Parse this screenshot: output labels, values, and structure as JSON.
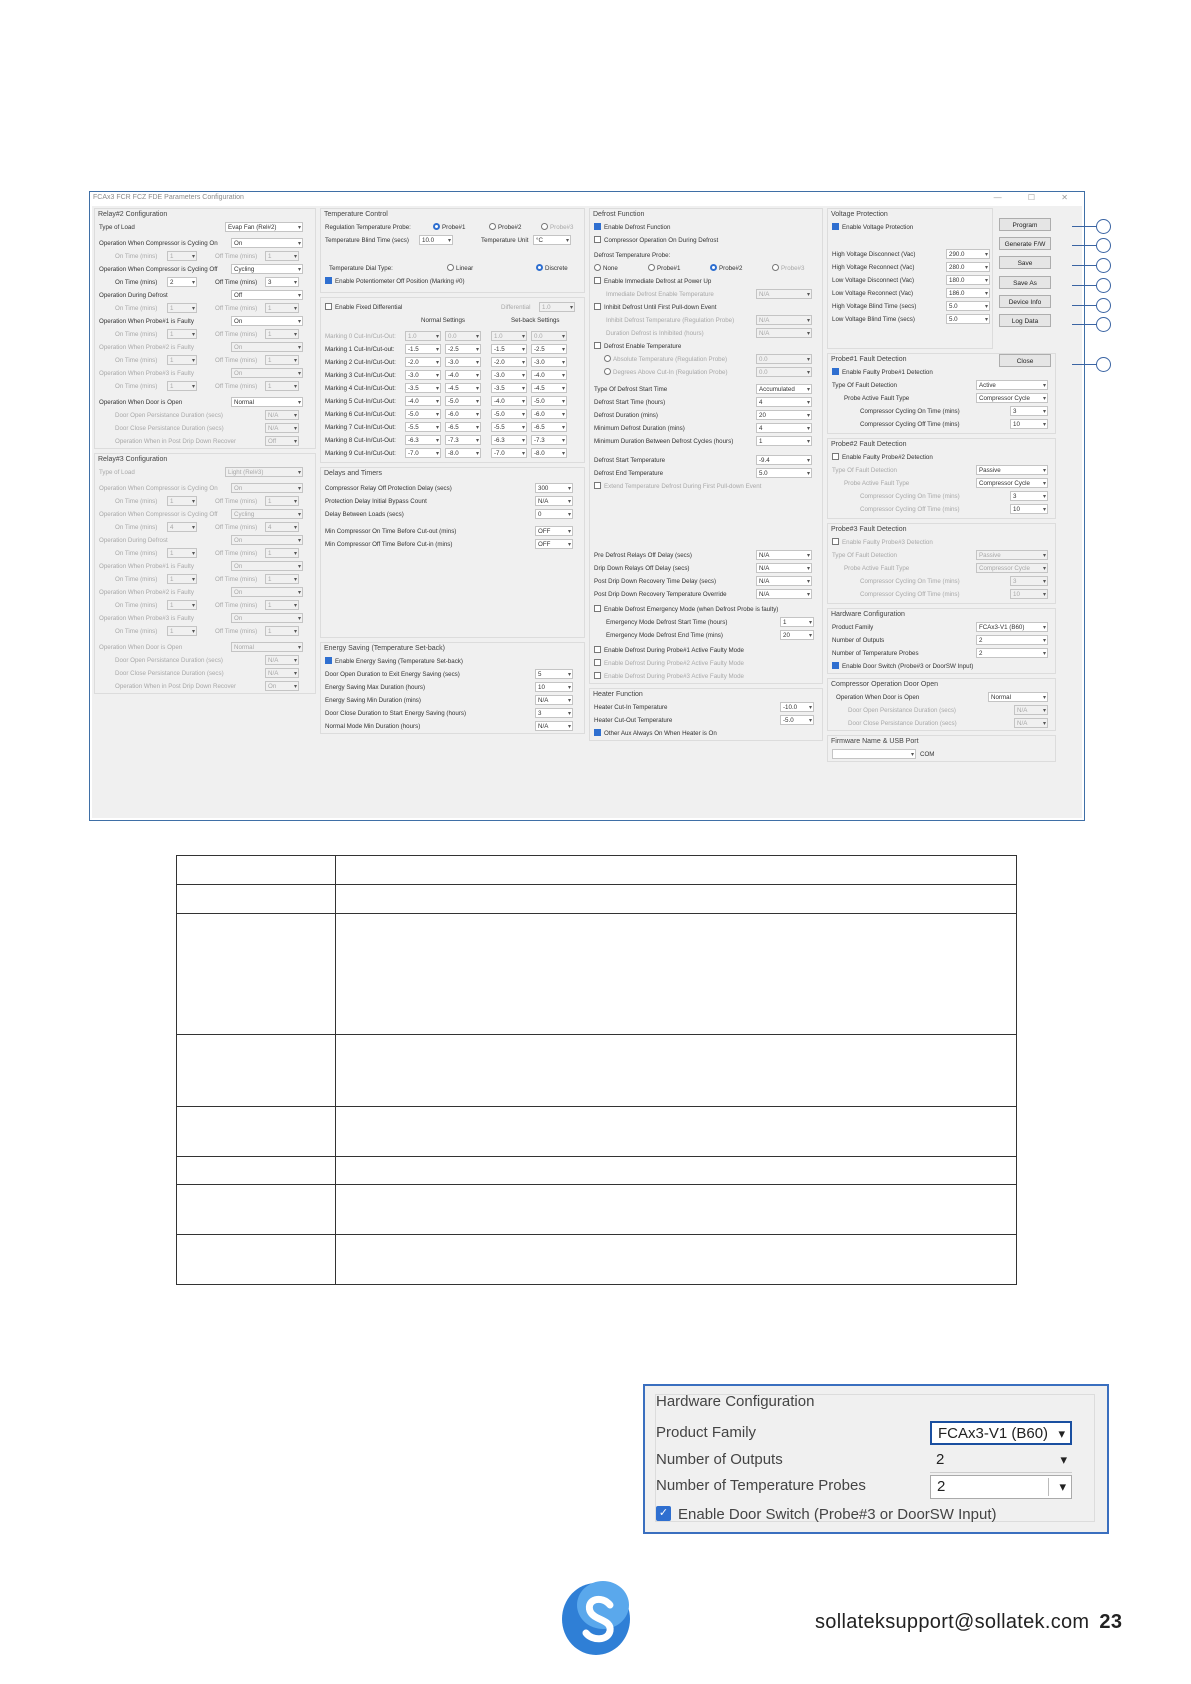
{
  "window": {
    "title": "FCAx3 FCR FCZ FDE Parameters Configuration",
    "controls": "— ☐ ✕"
  },
  "col1": {
    "relay2": {
      "header": "Relay#2 Configuration",
      "type_label": "Type of Load",
      "type_value": "Evap Fan (Rel#2)",
      "rows": [
        {
          "label": "Operation When Compressor is Cycling On",
          "value": "On",
          "dim": false
        },
        {
          "label": "On Time (mins)",
          "v1": "1",
          "label2": "Off Time (mins)",
          "v2": "1",
          "dim": true
        },
        {
          "label": "Operation When Compressor is Cycling Off",
          "value": "Cycling",
          "dim": false
        },
        {
          "label": "On Time (mins)",
          "v1": "2",
          "label2": "Off Time (mins)",
          "v2": "3",
          "dim": false
        },
        {
          "label": "Operation During Defrost",
          "value": "Off",
          "dim": false
        },
        {
          "label": "On Time (mins)",
          "v1": "1",
          "label2": "Off Time (mins)",
          "v2": "1",
          "dim": true
        },
        {
          "label": "Operation When Probe#1 is Faulty",
          "value": "On",
          "dim": false
        },
        {
          "label": "On Time (mins)",
          "v1": "1",
          "label2": "Off Time (mins)",
          "v2": "1",
          "dim": true
        },
        {
          "label": "Operation When Probe#2 is Faulty",
          "value": "On",
          "dim": true
        },
        {
          "label": "On Time (mins)",
          "v1": "1",
          "label2": "Off Time (mins)",
          "v2": "1",
          "dim": true
        },
        {
          "label": "Operation When Probe#3 is Faulty",
          "value": "On",
          "dim": true
        },
        {
          "label": "On Time (mins)",
          "v1": "1",
          "label2": "Off Time (mins)",
          "v2": "1",
          "dim": true
        },
        {
          "label": "Operation When Door is Open",
          "value": "Normal",
          "dim": false
        },
        {
          "label": "Door Open Persistance Duration (secs)",
          "value": "N/A",
          "dim": true
        },
        {
          "label": "Door Close Persistance Duration (secs)",
          "value": "N/A",
          "dim": true
        },
        {
          "label": "Operation When in Post Drip Down Recover",
          "value": "Off",
          "dim": true
        }
      ]
    },
    "relay3": {
      "header": "Relay#3 Configuration",
      "type_label": "Type of Load",
      "type_value": "Light (Rel#3)",
      "rows": [
        {
          "label": "Operation When Compressor is Cycling On",
          "value": "On",
          "dim": true
        },
        {
          "label": "On Time (mins)",
          "v1": "1",
          "label2": "Off Time (mins)",
          "v2": "1",
          "dim": true
        },
        {
          "label": "Operation When Compressor is Cycling Off",
          "value": "Cycling",
          "dim": true
        },
        {
          "label": "On Time (mins)",
          "v1": "4",
          "label2": "Off Time (mins)",
          "v2": "4",
          "dim": true
        },
        {
          "label": "Operation During Defrost",
          "value": "On",
          "dim": true
        },
        {
          "label": "On Time (mins)",
          "v1": "1",
          "label2": "Off Time (mins)",
          "v2": "1",
          "dim": true
        },
        {
          "label": "Operation When Probe#1 is Faulty",
          "value": "On",
          "dim": true
        },
        {
          "label": "On Time (mins)",
          "v1": "1",
          "label2": "Off Time (mins)",
          "v2": "1",
          "dim": true
        },
        {
          "label": "Operation When Probe#2 is Faulty",
          "value": "On",
          "dim": true
        },
        {
          "label": "On Time (mins)",
          "v1": "1",
          "label2": "Off Time (mins)",
          "v2": "1",
          "dim": true
        },
        {
          "label": "Operation When Probe#3 is Faulty",
          "value": "On",
          "dim": true
        },
        {
          "label": "On Time (mins)",
          "v1": "1",
          "label2": "Off Time (mins)",
          "v2": "1",
          "dim": true
        },
        {
          "label": "Operation When Door is Open",
          "value": "Normal",
          "dim": true
        },
        {
          "label": "Door Open Persistance Duration (secs)",
          "value": "N/A",
          "dim": true
        },
        {
          "label": "Door Close Persistance Duration (secs)",
          "value": "N/A",
          "dim": true
        },
        {
          "label": "Operation When in Post Drip Down Recover",
          "value": "On",
          "dim": true
        }
      ]
    }
  },
  "col2": {
    "temp": {
      "header": "Temperature Control",
      "reg_label": "Regulation Temperature Probe:",
      "probes": [
        "Probe#1",
        "Probe#2",
        "Probe#3"
      ],
      "blind_label": "Temperature Blind Time (secs)",
      "blind_value": "10.0",
      "unit_label": "Temperature Unit",
      "unit_value": "°C",
      "dial_label": "Temperature Dial Type:",
      "dial_linear": "Linear",
      "dial_discrete": "Discrete",
      "pot_label": "Enable Potentiometer Off Position (Marking #0)"
    },
    "diff": {
      "fixed_label": "Enable Fixed Differential",
      "diff_label": "Differential",
      "diff_value": "1.0",
      "normal_head": "Normal Settings",
      "setback_head": "Set-back Settings",
      "markings": [
        {
          "label": "Marking 0 Cut-In/Cut-Out:",
          "a": "1.0",
          "b": "0.0",
          "c": "1.0",
          "d": "0.0",
          "dim": true
        },
        {
          "label": "Marking 1 Cut-In/Cut-out:",
          "a": "-1.5",
          "b": "-2.5",
          "c": "-1.5",
          "d": "-2.5",
          "dim": false
        },
        {
          "label": "Marking 2 Cut-In/Cut-Out:",
          "a": "-2.0",
          "b": "-3.0",
          "c": "-2.0",
          "d": "-3.0",
          "dim": false
        },
        {
          "label": "Marking 3 Cut-In/Cut-Out:",
          "a": "-3.0",
          "b": "-4.0",
          "c": "-3.0",
          "d": "-4.0",
          "dim": false
        },
        {
          "label": "Marking 4 Cut-In/Cut-Out:",
          "a": "-3.5",
          "b": "-4.5",
          "c": "-3.5",
          "d": "-4.5",
          "dim": false
        },
        {
          "label": "Marking 5 Cut-In/Cut-Out:",
          "a": "-4.0",
          "b": "-5.0",
          "c": "-4.0",
          "d": "-5.0",
          "dim": false
        },
        {
          "label": "Marking 6 Cut-In/Cut-Out:",
          "a": "-5.0",
          "b": "-6.0",
          "c": "-5.0",
          "d": "-6.0",
          "dim": false
        },
        {
          "label": "Marking 7 Cut-In/Cut-Out:",
          "a": "-5.5",
          "b": "-6.5",
          "c": "-5.5",
          "d": "-6.5",
          "dim": false
        },
        {
          "label": "Marking 8 Cut-In/Cut-Out:",
          "a": "-6.3",
          "b": "-7.3",
          "c": "-6.3",
          "d": "-7.3",
          "dim": false
        },
        {
          "label": "Marking 9 Cut-In/Cut-Out:",
          "a": "-7.0",
          "b": "-8.0",
          "c": "-7.0",
          "d": "-8.0",
          "dim": false
        }
      ]
    },
    "delays": {
      "header": "Delays and Timers",
      "rows": [
        {
          "label": "Compressor Relay Off Protection Delay (secs)",
          "value": "300"
        },
        {
          "label": "Protection Delay Initial Bypass Count",
          "value": "N/A"
        },
        {
          "label": "Delay Between Loads (secs)",
          "value": "0"
        },
        {
          "label": "Min Compressor On Time Before Cut-out (mins)",
          "value": "OFF"
        },
        {
          "label": "Min Compressor Off Time Before Cut-in (mins)",
          "value": "OFF"
        }
      ]
    },
    "energy": {
      "header": "Energy Saving (Temperature Set-back)",
      "enable_label": "Enable Energy Saving (Temperature Set-back)",
      "rows": [
        {
          "label": "Door Open Duration to Exit Energy Saving (secs)",
          "value": "5"
        },
        {
          "label": "Energy Saving Max Duration (hours)",
          "value": "10"
        },
        {
          "label": "Energy Saving Min Duration (mins)",
          "value": "N/A"
        },
        {
          "label": "Door Close Duration to Start Energy Saving (hours)",
          "value": "3"
        },
        {
          "label": "Normal Mode Min Duration (hours)",
          "value": "N/A"
        }
      ]
    }
  },
  "col3": {
    "defrost": {
      "header": "Defrost Function",
      "enable": "Enable Defrost Function",
      "comp_op": "Compressor Operation On During Defrost",
      "probe_label": "Defrost Temperature Probe:",
      "probe_opts": [
        "None",
        "Probe#1",
        "Probe#2",
        "Probe#3"
      ],
      "immediate": "Enable Immediate Defrost at Power Up",
      "immediate_temp_label": "Immediate Defrost Enable Temperature",
      "immediate_temp_value": "N/A",
      "inhibit": "Inhibit Defrost Until First Pull-down Event",
      "inhibit_temp_label": "Inhibit Defrost Temperature (Regulation Probe)",
      "inhibit_temp_value": "N/A",
      "inhibit_dur_label": "Duration Defrost is Inhibited (hours)",
      "inhibit_dur_value": "N/A",
      "enable_temp": "Defrost Enable Temperature",
      "abs_label": "Absolute Temperature (Regulation Probe)",
      "abs_value": "0.0",
      "deg_label": "Degrees Above Cut-In (Regulation Probe)",
      "deg_value": "0.0",
      "start_type_label": "Type Of Defrost Start Time",
      "start_type_value": "Accumulated",
      "rows": [
        {
          "label": "Defrost Start Time (hours)",
          "value": "4"
        },
        {
          "label": "Defrost Duration (mins)",
          "value": "20"
        },
        {
          "label": "Minimum Defrost Duration (mins)",
          "value": "4"
        },
        {
          "label": "Minimum Duration Between Defrost Cycles (hours)",
          "value": "1"
        }
      ],
      "start_temp_label": "Defrost Start Temperature",
      "start_temp_value": "-9.4",
      "end_temp_label": "Defrost End Temperature",
      "end_temp_value": "5.0",
      "extend": "Extend Temperature Defrost During First Pull-down Event",
      "rows2": [
        {
          "label": "Pre Defrost Relays Off Delay (secs)",
          "value": "N/A"
        },
        {
          "label": "Drip Down Relays Off Delay (secs)",
          "value": "N/A"
        },
        {
          "label": "Post Drip Down Recovery Time Delay (secs)",
          "value": "N/A"
        },
        {
          "label": "Post Drip Down Recovery Temperature Override",
          "value": "N/A"
        }
      ],
      "emergency": "Enable Defrost Emergency Mode (when Defrost Probe is faulty)",
      "em_start_label": "Emergency Mode Defrost Start Time (hours)",
      "em_start_value": "1",
      "em_end_label": "Emergency Mode Defrost End Time (mins)",
      "em_end_value": "20",
      "faulty1": "Enable Defrost During Probe#1 Active Faulty Mode",
      "faulty2": "Enable Defrost During Probe#2 Active Faulty Mode",
      "faulty3": "Enable Defrost During Probe#3 Active Faulty Mode"
    },
    "heater": {
      "header": "Heater Function",
      "cutin_label": "Heater Cut-In Temperature",
      "cutin_value": "-10.0",
      "cutout_label": "Heater Cut-Out Temperature",
      "cutout_value": "-5.0",
      "aux": "Other Aux Always On When Heater is On"
    }
  },
  "col4": {
    "voltage": {
      "header": "Voltage Protection",
      "enable": "Enable Voltage Protection",
      "rows": [
        {
          "label": "High Voltage Disconnect (Vac)",
          "value": "290.0"
        },
        {
          "label": "High Voltage Reconnect (Vac)",
          "value": "280.0"
        },
        {
          "label": "Low Voltage Disconnect (Vac)",
          "value": "180.0"
        },
        {
          "label": "Low Voltage Reconnect (Vac)",
          "value": "186.0"
        },
        {
          "label": "High Voltage Blind Time (secs)",
          "value": "5.0"
        },
        {
          "label": "Low Voltage Blind Time (secs)",
          "value": "5.0"
        }
      ]
    },
    "buttons": [
      "Program",
      "Generate F/W",
      "Save",
      "Save As",
      "Device Info",
      "Log Data",
      "Close"
    ],
    "probe1": {
      "header": "Probe#1 Fault Detection",
      "enable": "Enable Faulty Probe#1 Detection",
      "type_label": "Type Of Fault Detection",
      "type_value": "Active",
      "active_label": "Probe Active Fault Type",
      "active_value": "Compressor Cycle",
      "on_label": "Compressor Cycling On Time (mins)",
      "on_value": "3",
      "off_label": "Compressor Cycling Off Time (mins)",
      "off_value": "10"
    },
    "probe2": {
      "header": "Probe#2 Fault Detection",
      "enable": "Enable Faulty Probe#2 Detection",
      "type_label": "Type Of Fault Detection",
      "type_value": "Passive",
      "active_label": "Probe Active Fault Type",
      "active_value": "Compressor Cycle",
      "on_label": "Compressor Cycling On Time (mins)",
      "on_value": "3",
      "off_label": "Compressor Cycling Off Time (mins)",
      "off_value": "10"
    },
    "probe3": {
      "header": "Probe#3 Fault Detection",
      "enable": "Enable Faulty Probe#3 Detection",
      "type_label": "Type Of Fault Detection",
      "type_value": "Passive",
      "active_label": "Probe Active Fault Type",
      "active_value": "Compressor Cycle",
      "on_label": "Compressor Cycling On Time (mins)",
      "on_value": "3",
      "off_label": "Compressor Cycling Off Time (mins)",
      "off_value": "10"
    },
    "hw": {
      "header": "Hardware Configuration",
      "family_label": "Product Family",
      "family_value": "FCAx3-V1 (B60)",
      "outputs_label": "Number of Outputs",
      "outputs_value": "2",
      "probes_label": "Number of Temperature Probes",
      "probes_value": "2",
      "door": "Enable Door Switch (Probe#3 or DoorSW Input)"
    },
    "door": {
      "header": "Compressor Operation Door Open",
      "op_label": "Operation When Door is Open",
      "op_value": "Normal",
      "open_label": "Door Open Persistance Duration (secs)",
      "open_value": "N/A",
      "close_label": "Door Close Persistance Duration (secs)",
      "close_value": "N/A"
    },
    "fw": {
      "label": "Firmware Name & USB Port",
      "port": "COM"
    }
  },
  "zoom": {
    "header": "Hardware Configuration",
    "family_label": "Product Family",
    "family_value": "FCAx3-V1 (B60)",
    "outputs_label": "Number of Outputs",
    "outputs_value": "2",
    "probes_label": "Number of Temperature Probes",
    "probes_value": "2",
    "door": "Enable Door Switch (Probe#3 or DoorSW Input)"
  },
  "footer": {
    "email": "sollateksupport@sollatek.com",
    "page": "23"
  },
  "colors": {
    "accent": "#2f6fd0",
    "frame": "#3a64a3",
    "logo": "#2f7fd6"
  }
}
